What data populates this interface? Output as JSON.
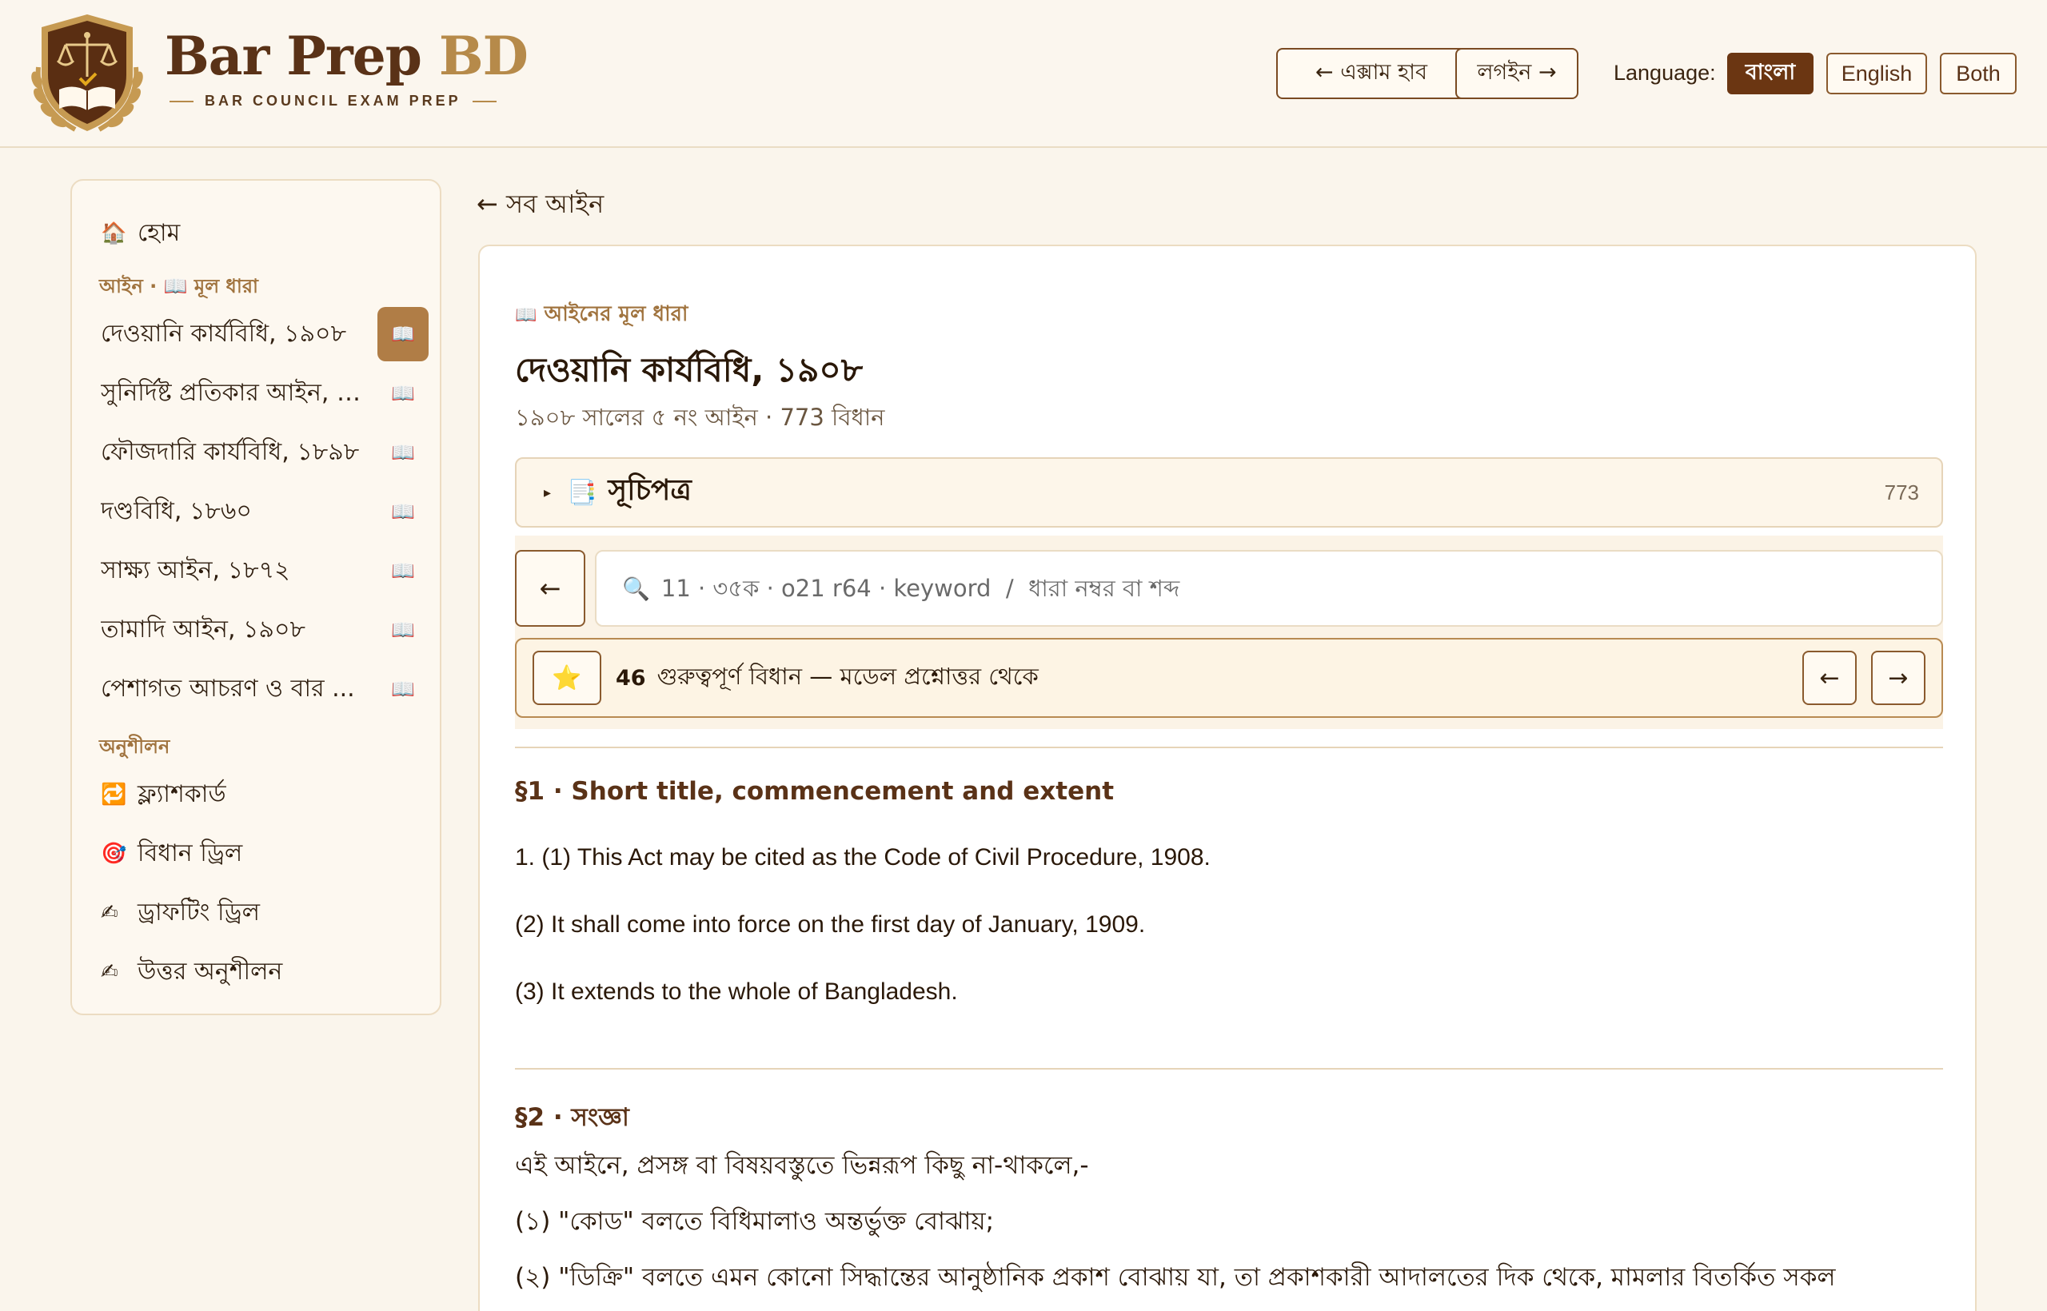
{
  "header": {
    "brand_part1": "Bar Prep",
    "brand_part2": "BD",
    "tagline": "BAR COUNCIL EXAM PREP",
    "exam_hub_button": "← এক্সাম হাব",
    "login_button": "লগইন →",
    "language_label": "Language:",
    "languages": [
      "বাংলা",
      "English",
      "Both"
    ],
    "active_language": "বাংলা"
  },
  "sidebar": {
    "home": {
      "icon": "house-icon",
      "label": "হোম"
    },
    "laws_section": "আইন · 📖 মূল ধারা",
    "laws": [
      {
        "label": "দেওয়ানি কার্যবিধি, ১৯০৮",
        "active": true
      },
      {
        "label": "সুনির্দিষ্ট প্রতিকার আইন, ১...",
        "active": false
      },
      {
        "label": "ফৌজদারি কার্যবিধি, ১৮৯৮",
        "active": false
      },
      {
        "label": "দণ্ডবিধি, ১৮৬০",
        "active": false
      },
      {
        "label": "সাক্ষ্য আইন, ১৮৭২",
        "active": false
      },
      {
        "label": "তামাদি আইন, ১৯০৮",
        "active": false
      },
      {
        "label": "পেশাগত আচরণ ও বার ...",
        "active": false
      }
    ],
    "practice_section": "অনুশীলন",
    "practice": [
      {
        "icon": "flashcard-icon",
        "label": "ফ্ল্যাশকার্ড"
      },
      {
        "icon": "target-icon",
        "label": "বিধান ড্রিল"
      },
      {
        "icon": "writing-hand-icon",
        "label": "ড্রাফটিং ড্রিল"
      },
      {
        "icon": "writing-hand-icon",
        "label": "উত্তর অনুশীলন"
      }
    ]
  },
  "main": {
    "back_link": "← সব আইন",
    "kicker": "আইনের মূল ধারা",
    "title": "দেওয়ানি কার্যবিধি, ১৯০৮",
    "meta": "১৯০৮ সালের ৫ নং আইন · 773 বিধান",
    "toc_label": "সূচিপত্র",
    "toc_count": "773",
    "search_placeholder": "11 · ৩৫ক · o21 r64 · keyword  /  ধারা নম্বর বা শব্দ",
    "important_count": "46",
    "important_text": "গুরুত্বপূর্ণ বিধান — মডেল প্রশ্নোত্তর থেকে",
    "sections": [
      {
        "heading": "§1 · Short title, commencement and extent",
        "paragraphs": [
          "1. (1) This Act may be cited as the Code of Civil Procedure, 1908.",
          "(2) It shall come into force on the first day of January, 1909.",
          "(3) It extends to the whole of Bangladesh."
        ]
      },
      {
        "heading": "§2 · সংজ্ঞা",
        "paragraphs": [
          "এই আইনে, প্রসঙ্গ বা বিষয়বস্তুতে ভিন্নরূপ কিছু না-থাকলে,-",
          "(১) \"কোড\" বলতে বিধিমালাও অন্তর্ভুক্ত বোঝায়;",
          "(২) \"ডিক্রি\" বলতে এমন কোনো সিদ্ধান্তের আনুষ্ঠানিক প্রকাশ বোঝায় যা, তা প্রকাশকারী আদালতের দিক থেকে, মামলার বিতর্কিত সকল"
        ]
      }
    ]
  },
  "colors": {
    "accent": "#6b3612",
    "gold": "#b68a4a",
    "background": "#faf5ec"
  }
}
